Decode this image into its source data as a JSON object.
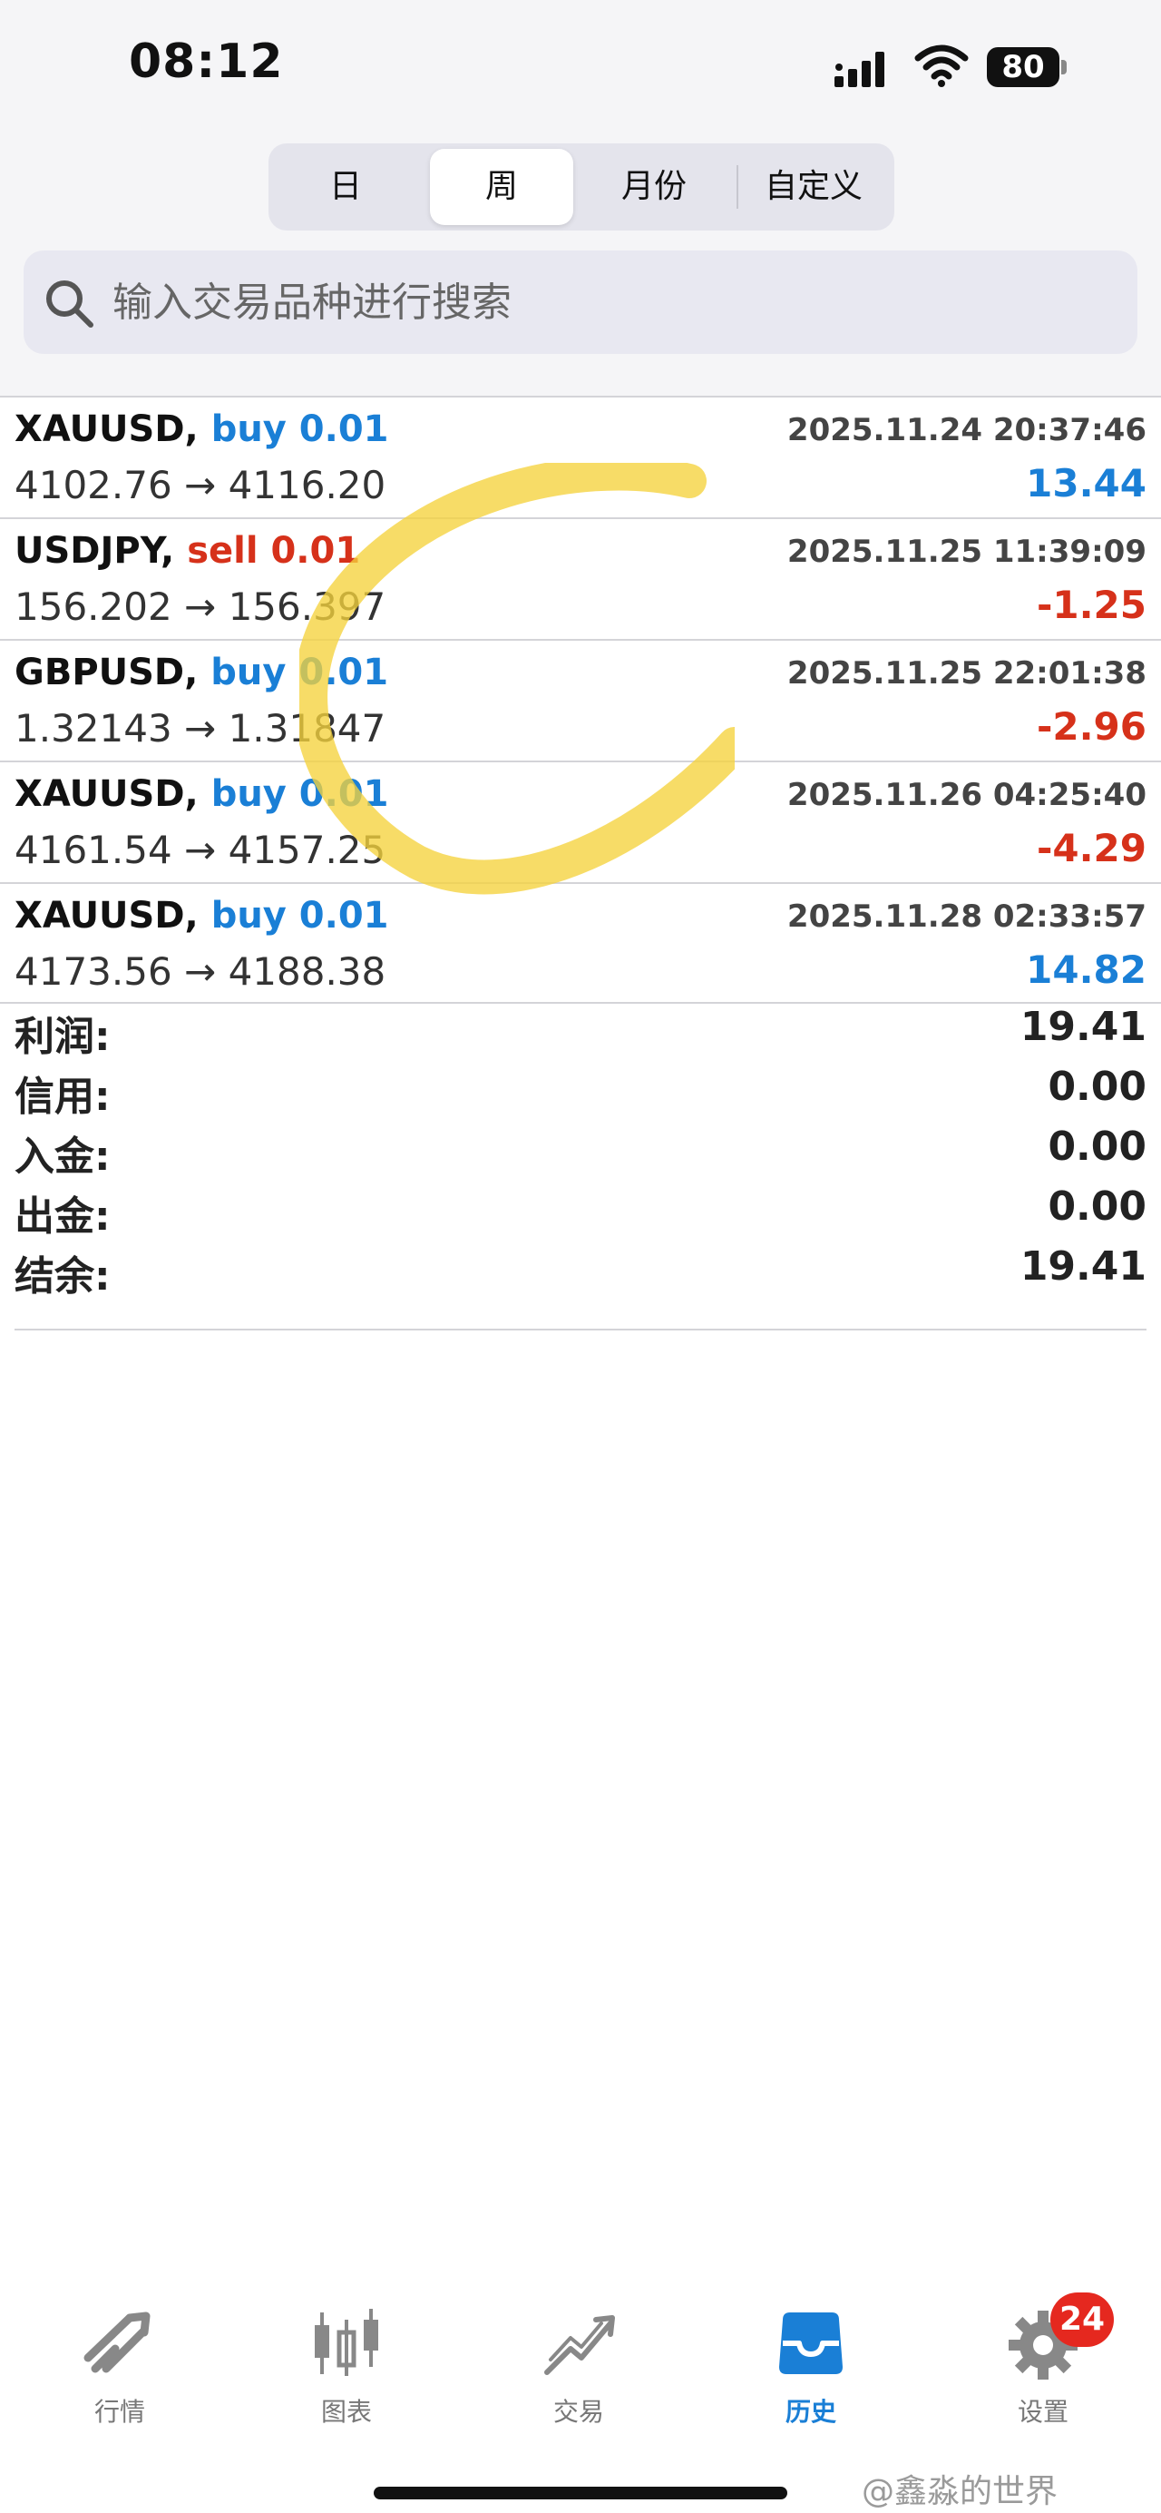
{
  "status_bar": {
    "time": "08:12",
    "battery": "80"
  },
  "segments": [
    {
      "label": "日",
      "active": false
    },
    {
      "label": "周",
      "active": true
    },
    {
      "label": "月份",
      "active": false
    },
    {
      "label": "自定义",
      "active": false
    }
  ],
  "search": {
    "placeholder": "输入交易品种进行搜索"
  },
  "trades": [
    {
      "symbol": "XAUUSD",
      "comma": ",",
      "type": "buy",
      "volume": "buy 0.01",
      "time": "2025.11.24 20:37:46",
      "prices": "4102.76 → 4116.20",
      "profit": "13.44"
    },
    {
      "symbol": "USDJPY",
      "comma": ",",
      "type": "sell",
      "volume": "sell 0.01",
      "time": "2025.11.25 11:39:09",
      "prices": "156.202 → 156.397",
      "profit": "-1.25"
    },
    {
      "symbol": "GBPUSD",
      "comma": ",",
      "type": "buy",
      "volume": "buy 0.01",
      "time": "2025.11.25 22:01:38",
      "prices": "1.32143 → 1.31847",
      "profit": "-2.96"
    },
    {
      "symbol": "XAUUSD",
      "comma": ",",
      "type": "buy",
      "volume": "buy 0.01",
      "time": "2025.11.26 04:25:40",
      "prices": "4161.54 → 4157.25",
      "profit": "-4.29"
    },
    {
      "symbol": "XAUUSD",
      "comma": ",",
      "type": "buy",
      "volume": "buy 0.01",
      "time": "2025.11.28 02:33:57",
      "prices": "4173.56 → 4188.38",
      "profit": "14.82"
    }
  ],
  "summary": [
    {
      "label": "利润:",
      "value": "19.41"
    },
    {
      "label": "信用:",
      "value": "0.00"
    },
    {
      "label": "入金:",
      "value": "0.00"
    },
    {
      "label": "出金:",
      "value": "0.00"
    },
    {
      "label": "结余:",
      "value": "19.41"
    }
  ],
  "tabbar": {
    "items": [
      {
        "label": "行情",
        "icon": "quotes-icon"
      },
      {
        "label": "图表",
        "icon": "chart-icon"
      },
      {
        "label": "交易",
        "icon": "trade-icon"
      },
      {
        "label": "历史",
        "icon": "history-icon"
      },
      {
        "label": "设置",
        "icon": "settings-icon"
      }
    ],
    "settings_badge": "24"
  },
  "watermark": "@鑫淼的世界",
  "colors": {
    "buy": "#1a7fd6",
    "sell": "#d6311a",
    "annotation": "#f5d23c"
  }
}
